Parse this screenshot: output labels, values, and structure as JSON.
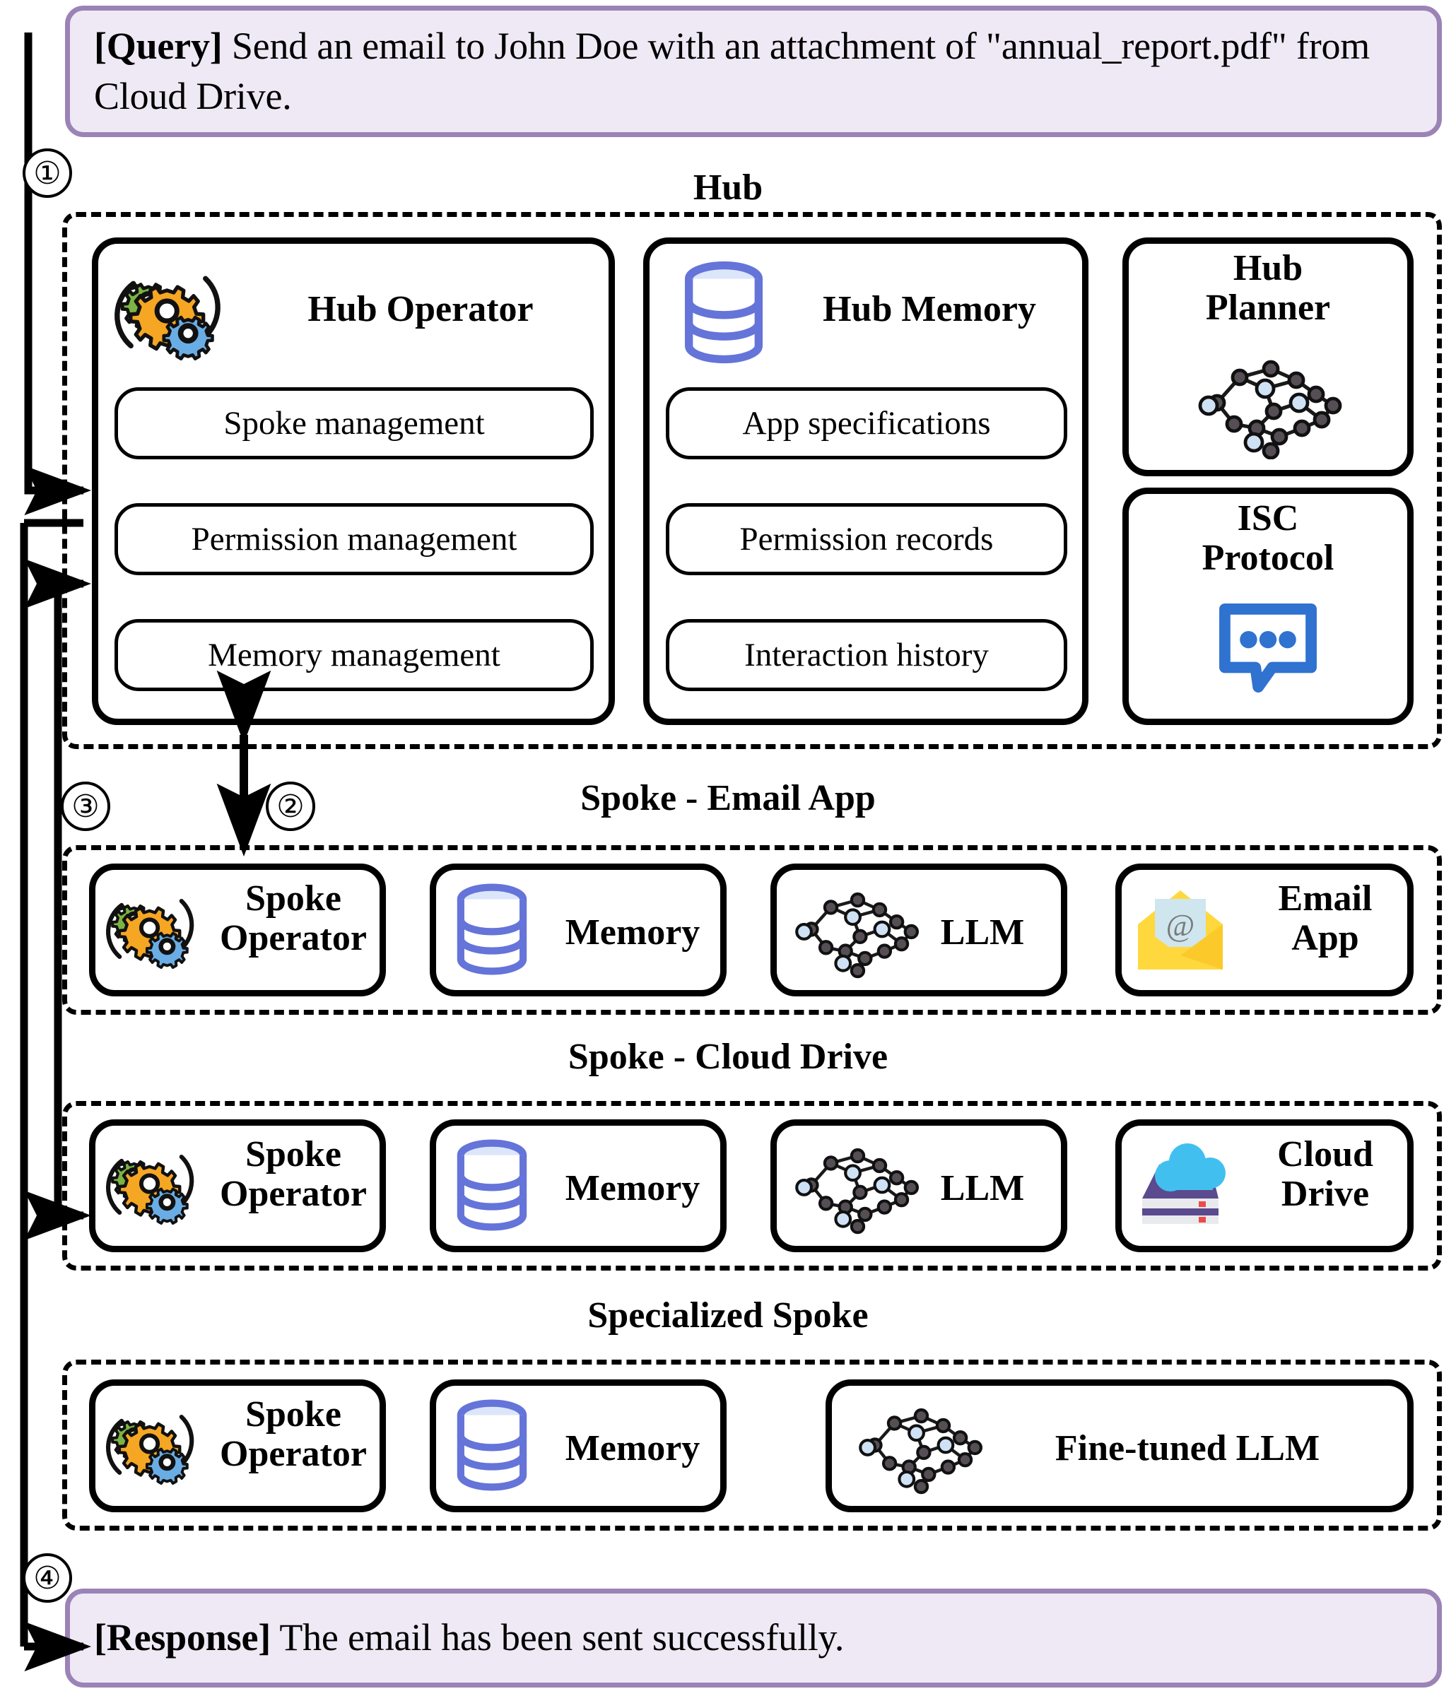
{
  "query": {
    "label": "[Query]",
    "text": " Send an email to John Doe with an attachment of \"annual_report.pdf\" from Cloud Drive."
  },
  "response": {
    "label": "[Response]",
    "text": " The email has been sent successfully."
  },
  "steps": {
    "s1": "①",
    "s2": "②",
    "s3": "③",
    "s4": "④"
  },
  "hub": {
    "title": "Hub",
    "operator": {
      "heading": "Hub Operator",
      "icon": "gears-icon",
      "items": [
        "Spoke management",
        "Permission management",
        "Memory management"
      ]
    },
    "memory": {
      "heading": "Hub Memory",
      "icon": "database-icon",
      "items": [
        "App specifications",
        "Permission records",
        "Interaction history"
      ]
    },
    "planner": {
      "heading": "Hub Planner",
      "heading_line1": "Hub",
      "heading_line2": "Planner",
      "icon": "neural-network-icon"
    },
    "isc": {
      "heading": "ISC Protocol",
      "heading_line1": "ISC",
      "heading_line2": "Protocol",
      "icon": "speech-bubble-icon"
    }
  },
  "spokes": [
    {
      "title": "Spoke - Email App",
      "cards": [
        {
          "label_line1": "Spoke",
          "label_line2": "Operator",
          "icon": "gears-icon",
          "two_line": true
        },
        {
          "label_line1": "Memory",
          "label_line2": "",
          "icon": "database-icon",
          "two_line": false
        },
        {
          "label_line1": "LLM",
          "label_line2": "",
          "icon": "neural-network-icon",
          "two_line": false
        },
        {
          "label_line1": "Email",
          "label_line2": "App",
          "icon": "email-envelope-icon",
          "two_line": true
        }
      ]
    },
    {
      "title": "Spoke - Cloud Drive",
      "cards": [
        {
          "label_line1": "Spoke",
          "label_line2": "Operator",
          "icon": "gears-icon",
          "two_line": true
        },
        {
          "label_line1": "Memory",
          "label_line2": "",
          "icon": "database-icon",
          "two_line": false
        },
        {
          "label_line1": "LLM",
          "label_line2": "",
          "icon": "neural-network-icon",
          "two_line": false
        },
        {
          "label_line1": "Cloud",
          "label_line2": "Drive",
          "icon": "cloud-drive-icon",
          "two_line": true
        }
      ]
    },
    {
      "title": "Specialized Spoke",
      "cards": [
        {
          "label_line1": "Spoke",
          "label_line2": "Operator",
          "icon": "gears-icon",
          "two_line": true
        },
        {
          "label_line1": "Memory",
          "label_line2": "",
          "icon": "database-icon",
          "two_line": false
        },
        {
          "label_line1": "Fine-tuned LLM",
          "label_line2": "",
          "icon": "neural-network-icon",
          "two_line": false
        }
      ]
    }
  ],
  "colors": {
    "banner_fill": "#efe9f5",
    "banner_border": "#9b83b6",
    "gear_green": "#7cb342",
    "gear_orange": "#f5a623",
    "gear_blue": "#6aade4",
    "database_blue": "#6574d8",
    "database_fill": "#dce6fb",
    "isc_blue": "#2f72d0",
    "node_dark": "#554f55",
    "node_light": "#cfe2f5",
    "envelope_yellow": "#ffd83d",
    "envelope_paper": "#cfe6ef",
    "cloud_blue": "#41c0f0",
    "drive_purple": "#5b4a8e"
  }
}
